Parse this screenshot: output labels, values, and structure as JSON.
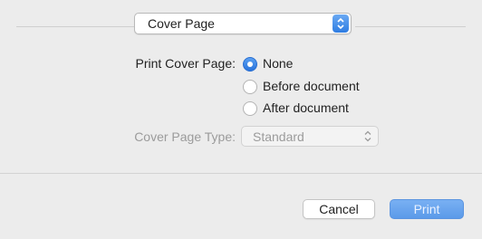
{
  "section_popup": {
    "value": "Cover Page"
  },
  "print_cover_page": {
    "label": "Print Cover Page:",
    "options": [
      {
        "label": "None",
        "selected": true
      },
      {
        "label": "Before document",
        "selected": false
      },
      {
        "label": "After document",
        "selected": false
      }
    ]
  },
  "cover_page_type": {
    "label": "Cover Page Type:",
    "value": "Standard",
    "enabled": false
  },
  "footer": {
    "cancel_label": "Cancel",
    "print_label": "Print"
  },
  "colors": {
    "accent": "#2f7de2",
    "print_button": "#5b9ae9"
  }
}
